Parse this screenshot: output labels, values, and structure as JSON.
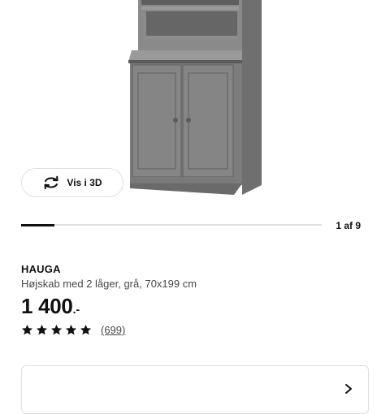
{
  "gallery": {
    "view_3d_label": "Vis i 3D",
    "counter": "1 af 9",
    "progress": 0.111
  },
  "product": {
    "name": "HAUGA",
    "description": "Højskab med 2 låger, grå, 70x199 cm",
    "price": "1 400",
    "price_suffix": ".-",
    "rating": 5,
    "review_count": "(699)"
  },
  "bottom_card": {
    "left_label": "",
    "right_label": ""
  },
  "colors": {
    "text": "#111111",
    "muted": "#484848",
    "border": "#dfdfdf",
    "cabinet": "#7a7a7a"
  },
  "icons": {
    "view_3d": "rotate-3d-icon",
    "star": "star-icon",
    "chevron": "chevron-right-icon"
  }
}
